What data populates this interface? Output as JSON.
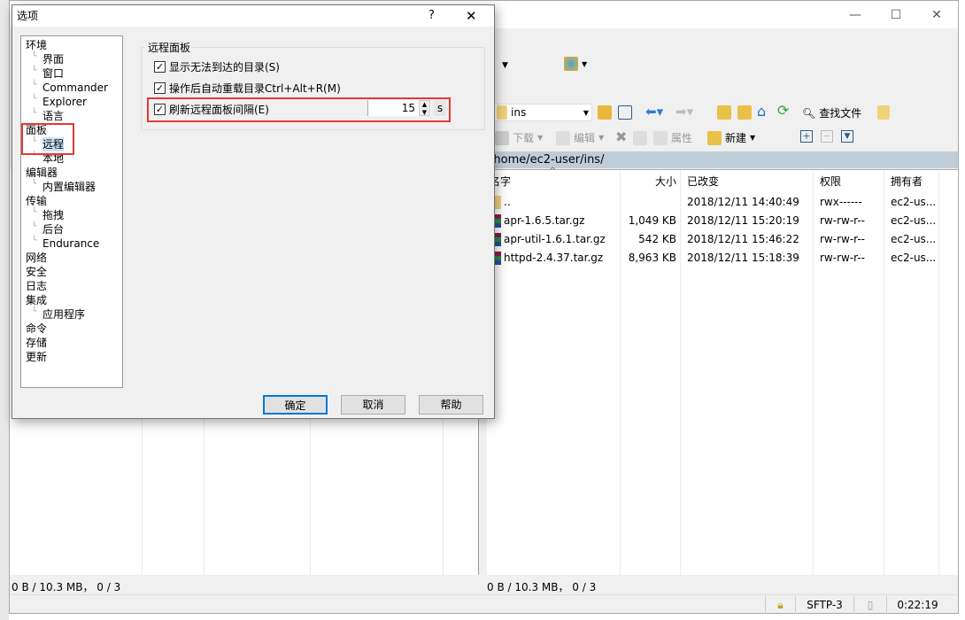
{
  "main_window": {
    "controls": {
      "minimize": "—",
      "maximize": "☐",
      "close": "✕"
    },
    "toolbar": {
      "dir_select": "ins",
      "find_files": "查找文件",
      "download": "下载",
      "edit": "编辑",
      "properties": "属性",
      "new": "新建"
    },
    "remote_panel": {
      "path": "/home/ec2-user/ins/",
      "columns": [
        "名字",
        "大小",
        "已改变",
        "权限",
        "拥有者"
      ],
      "rows": [
        {
          "name": "..",
          "size": "",
          "changed": "2018/12/11 14:40:49",
          "rights": "rwx------",
          "owner": "ec2-us...",
          "icon": "parent-folder-icon"
        },
        {
          "name": "apr-1.6.5.tar.gz",
          "size": "1,049 KB",
          "changed": "2018/12/11 15:20:19",
          "rights": "rw-rw-r--",
          "owner": "ec2-us...",
          "icon": "archive-icon"
        },
        {
          "name": "apr-util-1.6.1.tar.gz",
          "size": "542 KB",
          "changed": "2018/12/11 15:46:22",
          "rights": "rw-rw-r--",
          "owner": "ec2-us...",
          "icon": "archive-icon"
        },
        {
          "name": "httpd-2.4.37.tar.gz",
          "size": "8,963 KB",
          "changed": "2018/12/11 15:18:39",
          "rights": "rw-rw-r--",
          "owner": "ec2-us...",
          "icon": "archive-icon"
        }
      ],
      "status": "0 B / 10.3 MB， 0 / 3"
    },
    "local_panel": {
      "status": "0 B / 10.3 MB， 0 / 3"
    },
    "statusbar": {
      "protocol": "SFTP-3",
      "time": "0:22:19"
    }
  },
  "dialog": {
    "title": "选项",
    "help": "?",
    "close": "✕",
    "tree": [
      {
        "label": "环境",
        "level": 0
      },
      {
        "label": "界面",
        "level": 1
      },
      {
        "label": "窗口",
        "level": 1
      },
      {
        "label": "Commander",
        "level": 1
      },
      {
        "label": "Explorer",
        "level": 1
      },
      {
        "label": "语言",
        "level": 1
      },
      {
        "label": "面板",
        "level": 0
      },
      {
        "label": "远程",
        "level": 1,
        "selected": true
      },
      {
        "label": "本地",
        "level": 1
      },
      {
        "label": "编辑器",
        "level": 0
      },
      {
        "label": "内置编辑器",
        "level": 1
      },
      {
        "label": "传输",
        "level": 0
      },
      {
        "label": "拖拽",
        "level": 1
      },
      {
        "label": "后台",
        "level": 1
      },
      {
        "label": "Endurance",
        "level": 1
      },
      {
        "label": "网络",
        "level": 0
      },
      {
        "label": "安全",
        "level": 0
      },
      {
        "label": "日志",
        "level": 0
      },
      {
        "label": "集成",
        "level": 0
      },
      {
        "label": "应用程序",
        "level": 1
      },
      {
        "label": "命令",
        "level": 0
      },
      {
        "label": "存储",
        "level": 0
      },
      {
        "label": "更新",
        "level": 0
      }
    ],
    "group_title": "远程面板",
    "options": [
      {
        "label": "显示无法到达的目录(S)",
        "checked": true
      },
      {
        "label": "操作后自动重载目录Ctrl+Alt+R(M)",
        "checked": true
      },
      {
        "label": "刷新远程面板间隔(E)",
        "checked": true
      }
    ],
    "interval_value": "15",
    "interval_unit": "s",
    "buttons": {
      "ok": "确定",
      "cancel": "取消",
      "help": "帮助"
    },
    "highlight_color": "#e53935"
  }
}
